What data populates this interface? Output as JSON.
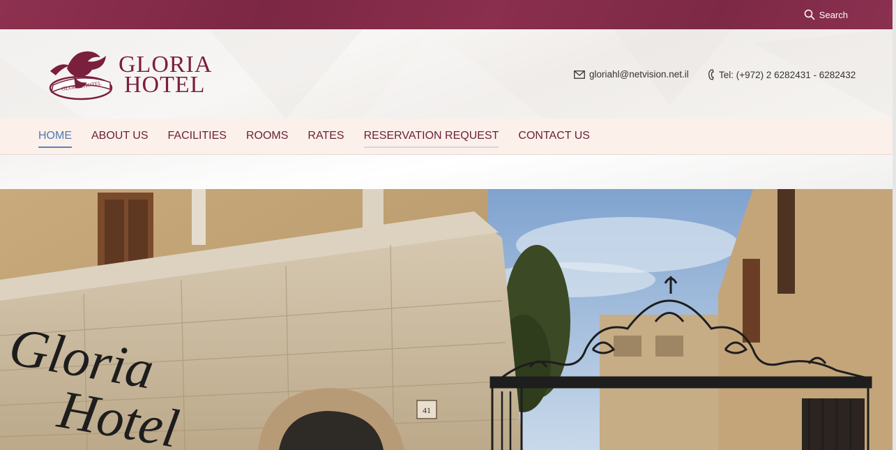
{
  "topbar": {
    "search_label": "Search",
    "search_icon": "magnifier",
    "color": "#862c4a"
  },
  "logo": {
    "line1": "GLORIA",
    "line2": "HOTEL",
    "emblem_text": "GLORIA HOTEL",
    "color": "#7a1f3d"
  },
  "contact": {
    "email": "gloriahl@netvision.net.il",
    "phone": "Tel: (+972) 2 6282431 - 6282432"
  },
  "nav": {
    "items": [
      {
        "label": "HOME"
      },
      {
        "label": "ABOUT US"
      },
      {
        "label": "FACILITIES"
      },
      {
        "label": "ROOMS"
      },
      {
        "label": "RATES"
      },
      {
        "label": "RESERVATION REQUEST"
      },
      {
        "label": "CONTACT US"
      }
    ],
    "active_color": "#4f79b5",
    "text_color": "#6a1f37"
  },
  "hero": {
    "sign_line1": "Gloria",
    "sign_line2": "Hotel",
    "house_number": "41"
  }
}
